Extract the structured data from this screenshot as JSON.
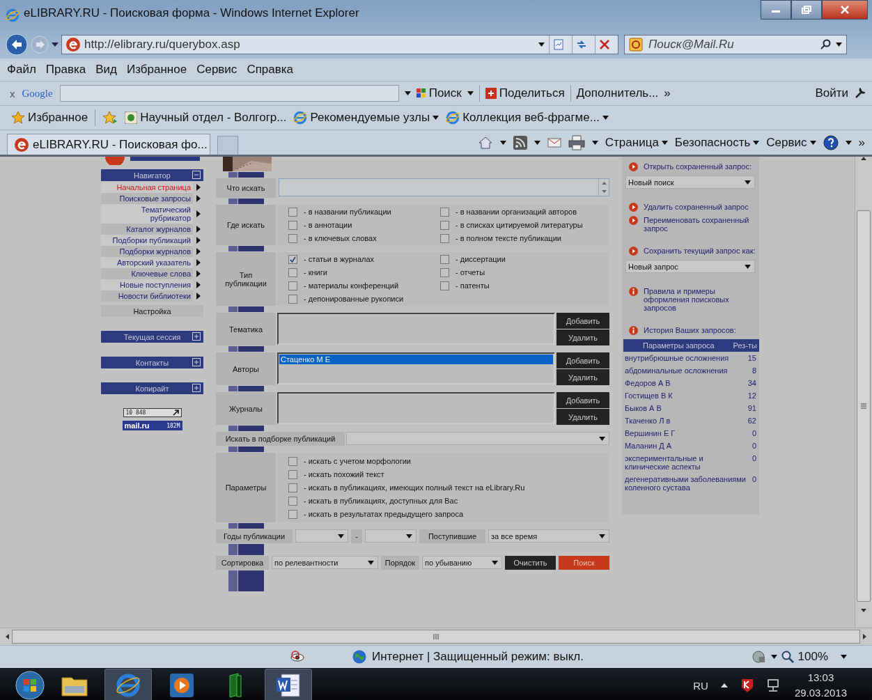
{
  "window": {
    "title": "eLIBRARY.RU - Поисковая форма - Windows Internet Explorer"
  },
  "address_bar": {
    "url": "http://elibrary.ru/querybox.asp",
    "search_placeholder": "Поиск@Mail.Ru"
  },
  "menu": [
    "Файл",
    "Правка",
    "Вид",
    "Избранное",
    "Сервис",
    "Справка"
  ],
  "google_toolbar": {
    "close": "x",
    "brand": "Google",
    "search": "Поиск",
    "share": "Поделиться",
    "more": "Дополнитель...",
    "overflow": "»",
    "login": "Войти"
  },
  "favorites_bar": {
    "label": "Избранное",
    "links": [
      "Научный отдел - Волгогр...",
      "Рекомендуемые узлы",
      "Коллекция веб-фрагме..."
    ]
  },
  "tabs": [
    {
      "label": "eLIBRARY.RU - Поисковая фо...",
      "selected": true
    }
  ],
  "command_bar": {
    "menus": [
      "Страница",
      "Безопасность",
      "Сервис"
    ],
    "overflow": "»"
  },
  "sidebar": {
    "sections": [
      {
        "title": "Навигатор",
        "expanded": true,
        "items": [
          {
            "label": "Начальная страница",
            "selected": true
          },
          {
            "label": "Поисковые запросы",
            "selected": false
          },
          {
            "label": "Тематический рубрикатор",
            "selected": false
          },
          {
            "label": "Каталог журналов",
            "selected": false
          },
          {
            "label": "Подборки публикаций",
            "selected": false
          },
          {
            "label": "Подборки журналов",
            "selected": false
          },
          {
            "label": "Авторский указатель",
            "selected": false
          },
          {
            "label": "Ключевые слова",
            "selected": false
          },
          {
            "label": "Новые поступления",
            "selected": false
          },
          {
            "label": "Новости библиотеки",
            "selected": false
          }
        ],
        "footer": "Настройка"
      },
      {
        "title": "Текущая сессия",
        "expanded": false
      },
      {
        "title": "Контакты",
        "expanded": false
      },
      {
        "title": "Копирайт",
        "expanded": false
      }
    ],
    "counters": [
      {
        "kind": "visits",
        "value": "10 848"
      },
      {
        "kind": "mailru",
        "brand": "mail.ru",
        "value": "182M"
      }
    ]
  },
  "form": {
    "query": {
      "label": "Что искать"
    },
    "where": {
      "label": "Где искать",
      "options": [
        {
          "label": "- в названии публикации",
          "checked": false
        },
        {
          "label": "- в аннотации",
          "checked": false
        },
        {
          "label": "- в ключевых словах",
          "checked": false
        },
        {
          "label": "- в названии организаций авторов",
          "checked": false
        },
        {
          "label": "- в списках цитируемой литературы",
          "checked": false
        },
        {
          "label": "- в полном тексте публикации",
          "checked": false
        }
      ]
    },
    "types": {
      "label": "Тип публикации",
      "options": [
        {
          "label": "- статьи в журналах",
          "checked": true
        },
        {
          "label": "- книги",
          "checked": false
        },
        {
          "label": "- материалы конференций",
          "checked": false
        },
        {
          "label": "- депонированные рукописи",
          "checked": false
        },
        {
          "label": "- диссертации",
          "checked": false
        },
        {
          "label": "- отчеты",
          "checked": false
        },
        {
          "label": "- патенты",
          "checked": false
        }
      ]
    },
    "lists": [
      {
        "label": "Тематика",
        "add": "Добавить",
        "remove": "Удалить"
      },
      {
        "label": "Авторы",
        "items": [
          {
            "label": "Стаценко М Е",
            "selected": true
          }
        ],
        "add": "Добавить",
        "remove": "Удалить"
      },
      {
        "label": "Журналы",
        "add": "Добавить",
        "remove": "Удалить"
      }
    ],
    "collection": {
      "label": "Искать в подборке публикаций"
    },
    "params": {
      "label": "Параметры",
      "options": [
        {
          "label": "- искать с учетом морфологии",
          "checked": false
        },
        {
          "label": "- искать похожий текст",
          "checked": false
        },
        {
          "label": "- искать в публикациях, имеющих полный текст на eLibrary.Ru",
          "checked": false
        },
        {
          "label": "- искать в публикациях, доступных для Вас",
          "checked": false
        },
        {
          "label": "- искать в результатах предыдущего запроса",
          "checked": false
        }
      ]
    },
    "years": {
      "label": "Годы публикации",
      "separator": "-",
      "received_label": "Поступившие",
      "received_value": "за все время"
    },
    "sorting": {
      "label": "Сортировка",
      "value": "по релевантности",
      "order_label": "Порядок",
      "order_value": "по убыванию",
      "clear": "Очистить",
      "search": "Поиск"
    }
  },
  "right_panel": {
    "groups": [
      [
        {
          "kind": "action",
          "label": "Открыть сохраненный запрос:"
        },
        {
          "kind": "select",
          "value": "Новый поиск"
        }
      ],
      [
        {
          "kind": "action",
          "label": "Удалить сохраненный запрос"
        },
        {
          "kind": "action",
          "label": "Переименовать сохраненный запрос"
        }
      ],
      [
        {
          "kind": "action",
          "label": "Сохранить текущий запрос как:"
        },
        {
          "kind": "select",
          "value": "Новый запрос"
        }
      ],
      [
        {
          "kind": "info",
          "label": "Правила и примеры оформления поисковых запросов"
        }
      ],
      [
        {
          "kind": "info",
          "label": "История Ваших запросов:"
        }
      ]
    ],
    "history": {
      "columns": [
        "Параметры запроса",
        "Рез-ты"
      ],
      "rows": [
        [
          "внутрибрюшные осложнения",
          "15"
        ],
        [
          "абдоминальные осложнения",
          "8"
        ],
        [
          "Федоров А В",
          "34"
        ],
        [
          "Гостищев В К",
          "12"
        ],
        [
          "Быков А В",
          "91"
        ],
        [
          "Ткаченко Л в",
          "62"
        ],
        [
          "Вершинин Е Г",
          "0"
        ],
        [
          "Маланин Д А",
          "0"
        ],
        [
          "экспериментальные и клинические аспекты",
          "0"
        ],
        [
          "дегенеративными заболеваниями коленного сустава",
          "0"
        ]
      ]
    }
  },
  "status_bar": {
    "zone": "Интернет | Защищенный режим: выкл.",
    "zoom": "100%"
  },
  "taskbar": {
    "language": "RU",
    "time": "13:03",
    "date": "29.03.2013"
  }
}
